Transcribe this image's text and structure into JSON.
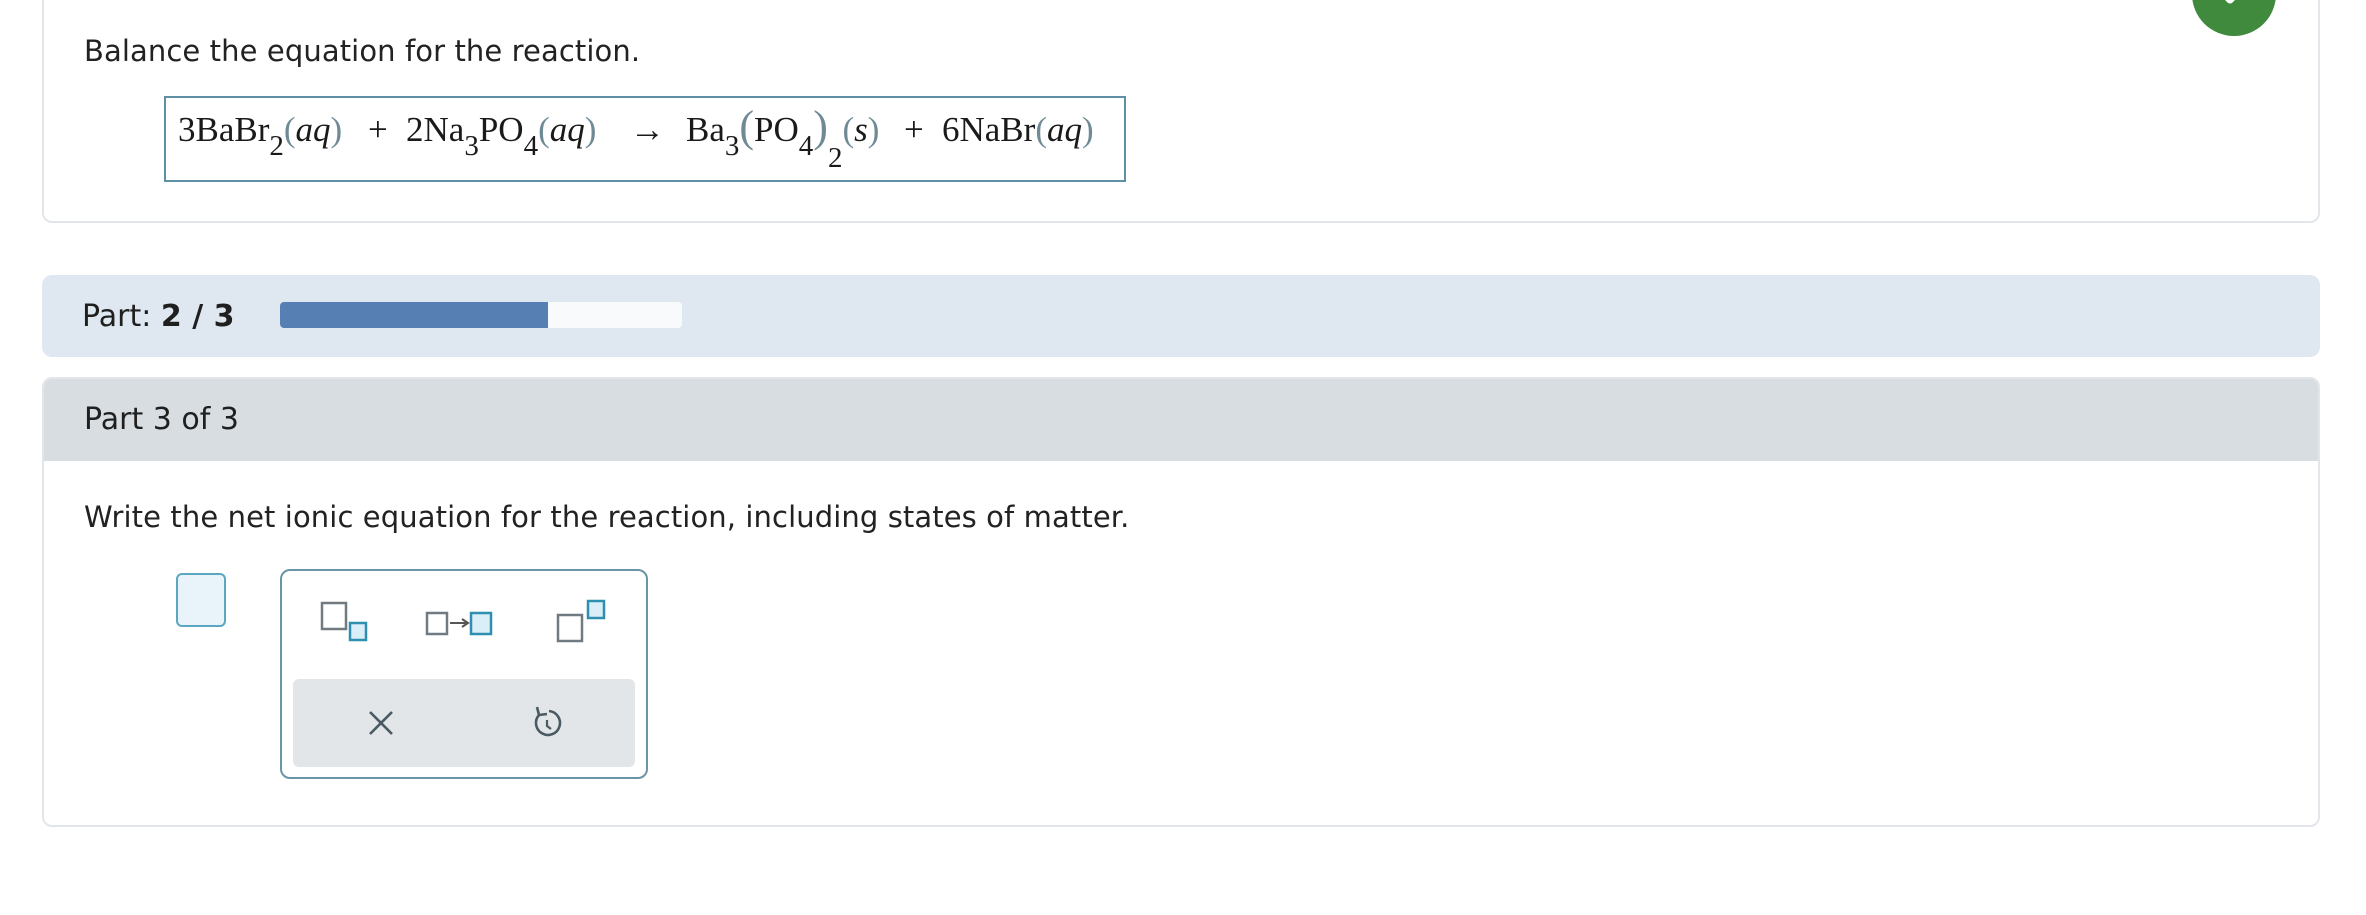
{
  "question": {
    "instruction": "Balance the equation for the reaction."
  },
  "equation": {
    "r1_coef": "3",
    "r1_formula": "BaBr",
    "r1_sub": "2",
    "r1_state": "aq",
    "plus1": "+",
    "r2_coef": "2",
    "r2_formula_a": "Na",
    "r2_sub_a": "3",
    "r2_formula_b": "PO",
    "r2_sub_b": "4",
    "r2_state": "aq",
    "arrow": "→",
    "p1_formula": "Ba",
    "p1_sub": "3",
    "p1_group": "PO",
    "p1_group_sub": "4",
    "p1_group_count": "2",
    "p1_state": "s",
    "plus2": "+",
    "p2_coef": "6",
    "p2_formula": "NaBr",
    "p2_state": "aq"
  },
  "progress": {
    "label": "Part:",
    "value": "2 / 3",
    "fraction": 0.667,
    "fill_color": "#5680b4"
  },
  "part": {
    "header": "Part 3 of 3",
    "prompt": "Write the net ionic equation for the reaction, including states of matter."
  },
  "palette": {
    "buttons": [
      "subscript-icon",
      "reaction-arrow-icon",
      "superscript-icon"
    ],
    "actions": [
      "clear-icon",
      "undo-icon"
    ]
  },
  "colors": {
    "success": "#3f8a3d",
    "accent": "#5da6c2",
    "header_bg": "#d7dde1",
    "progress_bg": "#dfe8f0"
  }
}
